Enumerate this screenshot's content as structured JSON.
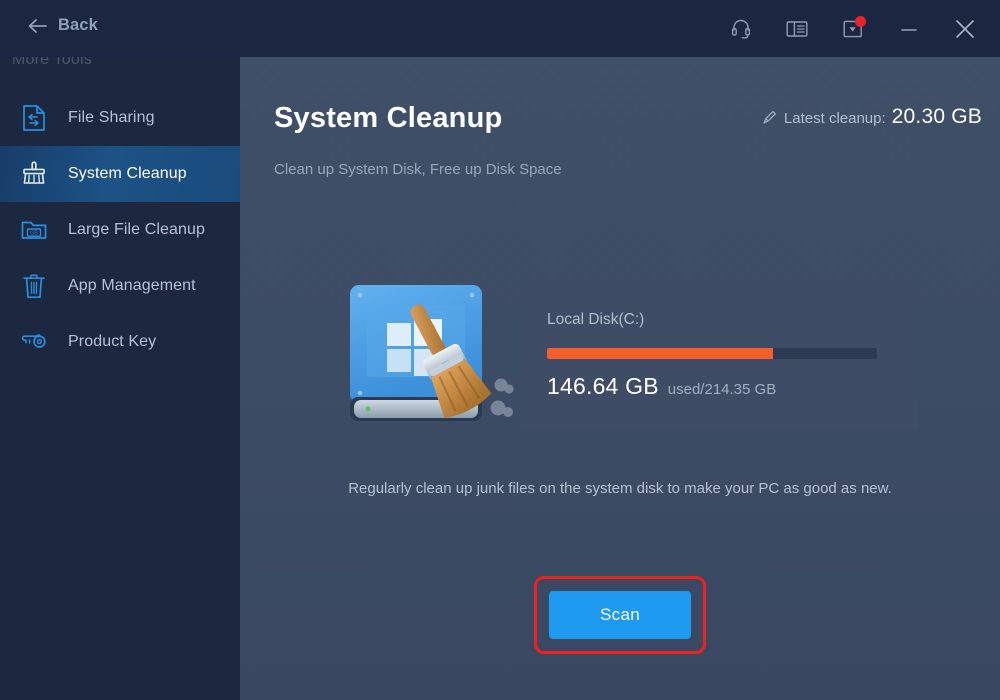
{
  "titlebar": {
    "back_label": "Back",
    "icons": [
      {
        "name": "headset-icon",
        "label": "Support"
      },
      {
        "name": "book-icon",
        "label": "User Guide"
      },
      {
        "name": "download-update-icon",
        "label": "Updates",
        "badge": true
      },
      {
        "name": "minimize-icon",
        "label": "Minimize"
      },
      {
        "name": "close-icon",
        "label": "Close"
      }
    ]
  },
  "sidebar": {
    "title": "More Tools",
    "items": [
      {
        "label": "File Sharing",
        "icon": "file-sharing-icon",
        "active": false
      },
      {
        "label": "System Cleanup",
        "icon": "broom-icon",
        "active": true
      },
      {
        "label": "Large File Cleanup",
        "icon": "folder-gb-icon",
        "active": false
      },
      {
        "label": "App Management",
        "icon": "trash-icon",
        "active": false
      },
      {
        "label": "Product Key",
        "icon": "key-icon",
        "active": false
      }
    ]
  },
  "main": {
    "title": "System Cleanup",
    "subtitle": "Clean up System Disk, Free up Disk Space",
    "latest_cleanup_label": "Latest cleanup:",
    "latest_cleanup_value": "20.30 GB",
    "disk": {
      "name": "Local Disk(C:)",
      "used": "146.64 GB",
      "total_text": "used/214.35 GB",
      "used_percent": 68.4
    },
    "description": "Regularly clean up junk files on the system disk to make your PC as good as new.",
    "scan_label": "Scan"
  },
  "colors": {
    "titlebar_bg": "#1b2740",
    "sidebar_bg": "#1c2840",
    "sidebar_active": "#1c5286",
    "content_bg": "#3e4d66",
    "card_bg": "#3e4d65",
    "accent_blue": "#1e9bf0",
    "icon_blue": "#2a8fe0",
    "bar_orange": "#f4602c",
    "bar_track": "#2c3a52",
    "highlight_red": "#ef2020",
    "badge_red": "#e8232a"
  }
}
